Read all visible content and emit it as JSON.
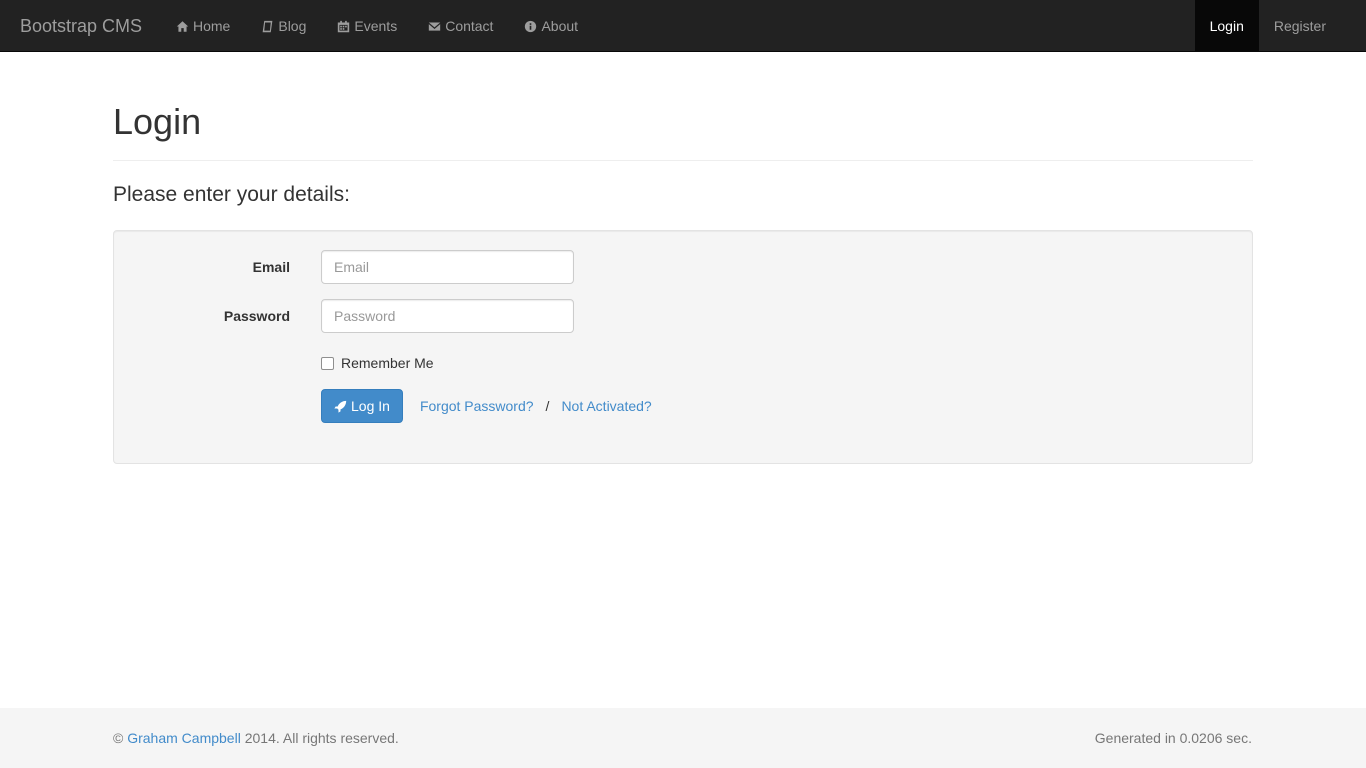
{
  "navbar": {
    "brand": "Bootstrap CMS",
    "items": [
      {
        "label": "Home",
        "icon": "home-icon"
      },
      {
        "label": "Blog",
        "icon": "book-icon"
      },
      {
        "label": "Events",
        "icon": "calendar-icon"
      },
      {
        "label": "Contact",
        "icon": "envelope-icon"
      },
      {
        "label": "About",
        "icon": "info-icon"
      }
    ],
    "right": [
      {
        "label": "Login",
        "active": true
      },
      {
        "label": "Register",
        "active": false
      }
    ]
  },
  "page": {
    "title": "Login",
    "lead": "Please enter your details:"
  },
  "form": {
    "email_label": "Email",
    "email_placeholder": "Email",
    "email_value": "",
    "password_label": "Password",
    "password_placeholder": "Password",
    "password_value": "",
    "remember_label": "Remember Me",
    "remember_checked": false,
    "login_button": "Log In",
    "forgot_link": "Forgot Password?",
    "separator": "/",
    "not_activated_link": "Not Activated?"
  },
  "footer": {
    "copyright_symbol": "©",
    "author": "Graham Campbell",
    "copyright_text": "2014. All rights reserved.",
    "generated": "Generated in 0.0206 sec."
  },
  "colors": {
    "navbar_bg": "#222222",
    "accent": "#428bca",
    "well_bg": "#f5f5f5"
  }
}
